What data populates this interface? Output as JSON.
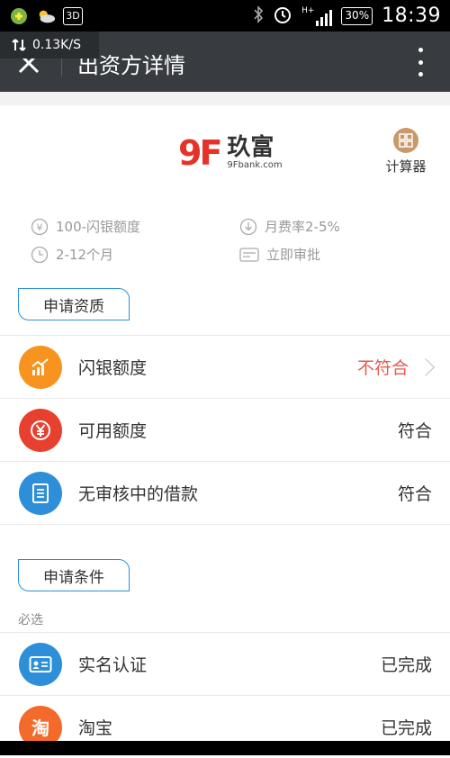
{
  "status_bar": {
    "time": "18:39",
    "battery": "30%",
    "net_speed": "0.13K/S",
    "net_type": "H+",
    "badge_3d": "3D"
  },
  "app_bar": {
    "title": "出资方详情"
  },
  "header": {
    "logo_mark": "9F",
    "logo_name": "玖富",
    "logo_url": "9Fbank.com",
    "calculator_label": "计算器"
  },
  "info": {
    "amount": "100-闪银额度",
    "fee_rate": "月费率2-5%",
    "term": "2-12个月",
    "approval": "立即审批"
  },
  "qualification": {
    "title": "申请资质",
    "items": [
      {
        "label": "闪银额度",
        "status": "不符合",
        "icon": "chart-growth-icon",
        "color": "#f7931e"
      },
      {
        "label": "可用额度",
        "status": "符合",
        "icon": "yuan-icon",
        "color": "#e8402e"
      },
      {
        "label": "无审核中的借款",
        "status": "符合",
        "icon": "document-list-icon",
        "color": "#2d8fd8"
      }
    ]
  },
  "conditions": {
    "title": "申请条件",
    "required_label": "必选",
    "items": [
      {
        "label": "实名认证",
        "status": "已完成",
        "icon": "id-card-icon",
        "color": "#2d8fd8"
      },
      {
        "label": "淘宝",
        "status": "已完成",
        "icon": "taobao-icon",
        "color": "#f26b2a",
        "glyph": "淘"
      }
    ]
  }
}
